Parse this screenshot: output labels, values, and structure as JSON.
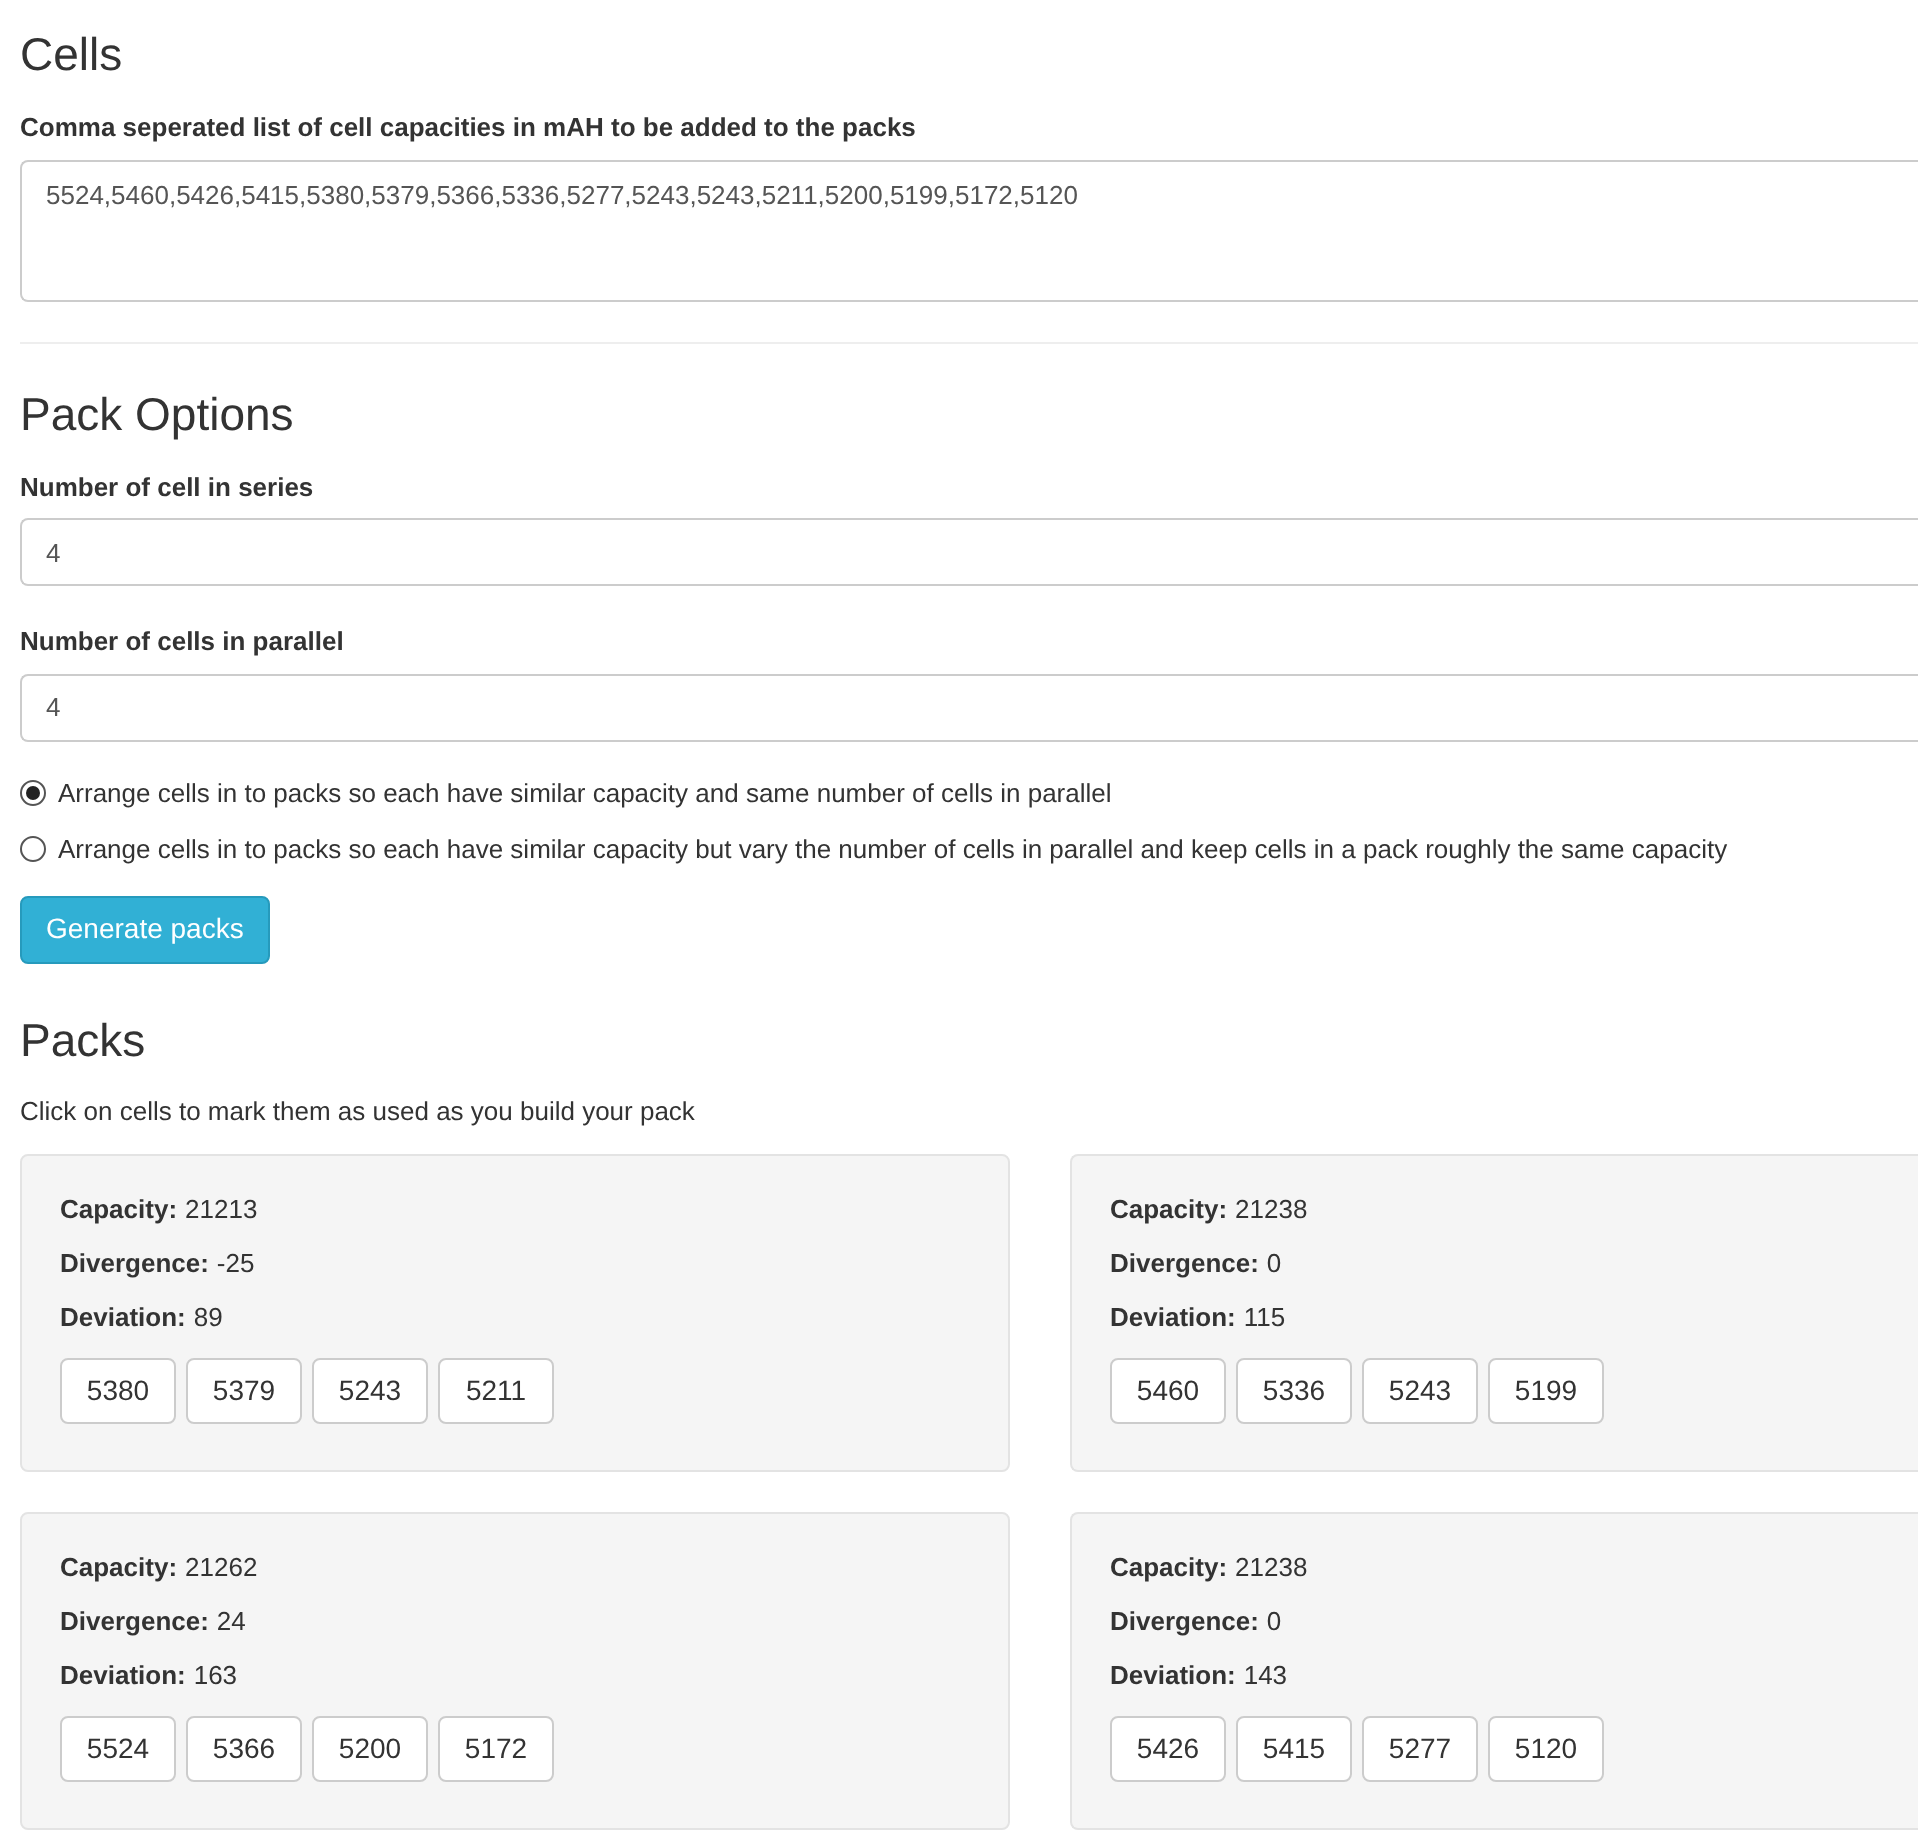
{
  "cells": {
    "heading": "Cells",
    "label": "Comma seperated list of cell capacities in mAH to be added to the packs",
    "value": "5524,5460,5426,5415,5380,5379,5366,5336,5277,5243,5243,5211,5200,5199,5172,5120"
  },
  "pack_options": {
    "heading": "Pack Options",
    "fields": [
      {
        "label": "Number of cell in series",
        "value": "4"
      },
      {
        "label": "Number of cells in parallel",
        "value": "4"
      }
    ],
    "modes": [
      {
        "label": "Arrange cells in to packs so each have similar capacity and same number of cells in parallel",
        "selected": true
      },
      {
        "label": "Arrange cells in to packs so each have similar capacity but vary the number of cells in parallel and keep cells in a pack roughly the same capacity",
        "selected": false
      }
    ],
    "button": "Generate packs"
  },
  "packs": {
    "heading": "Packs",
    "hint": "Click on cells to mark them as used as you build your pack",
    "items": [
      {
        "stats": [
          {
            "label": "Capacity:",
            "value": "21213"
          },
          {
            "label": "Divergence:",
            "value": "-25"
          },
          {
            "label": "Deviation:",
            "value": "89"
          }
        ],
        "cells": [
          "5380",
          "5379",
          "5243",
          "5211"
        ]
      },
      {
        "stats": [
          {
            "label": "Capacity:",
            "value": "21238"
          },
          {
            "label": "Divergence:",
            "value": "0"
          },
          {
            "label": "Deviation:",
            "value": "115"
          }
        ],
        "cells": [
          "5460",
          "5336",
          "5243",
          "5199"
        ]
      },
      {
        "stats": [
          {
            "label": "Capacity:",
            "value": "21262"
          },
          {
            "label": "Divergence:",
            "value": "24"
          },
          {
            "label": "Deviation:",
            "value": "163"
          }
        ],
        "cells": [
          "5524",
          "5366",
          "5200",
          "5172"
        ]
      },
      {
        "stats": [
          {
            "label": "Capacity:",
            "value": "21238"
          },
          {
            "label": "Divergence:",
            "value": "0"
          },
          {
            "label": "Deviation:",
            "value": "143"
          }
        ],
        "cells": [
          "5426",
          "5415",
          "5277",
          "5120"
        ]
      }
    ]
  }
}
